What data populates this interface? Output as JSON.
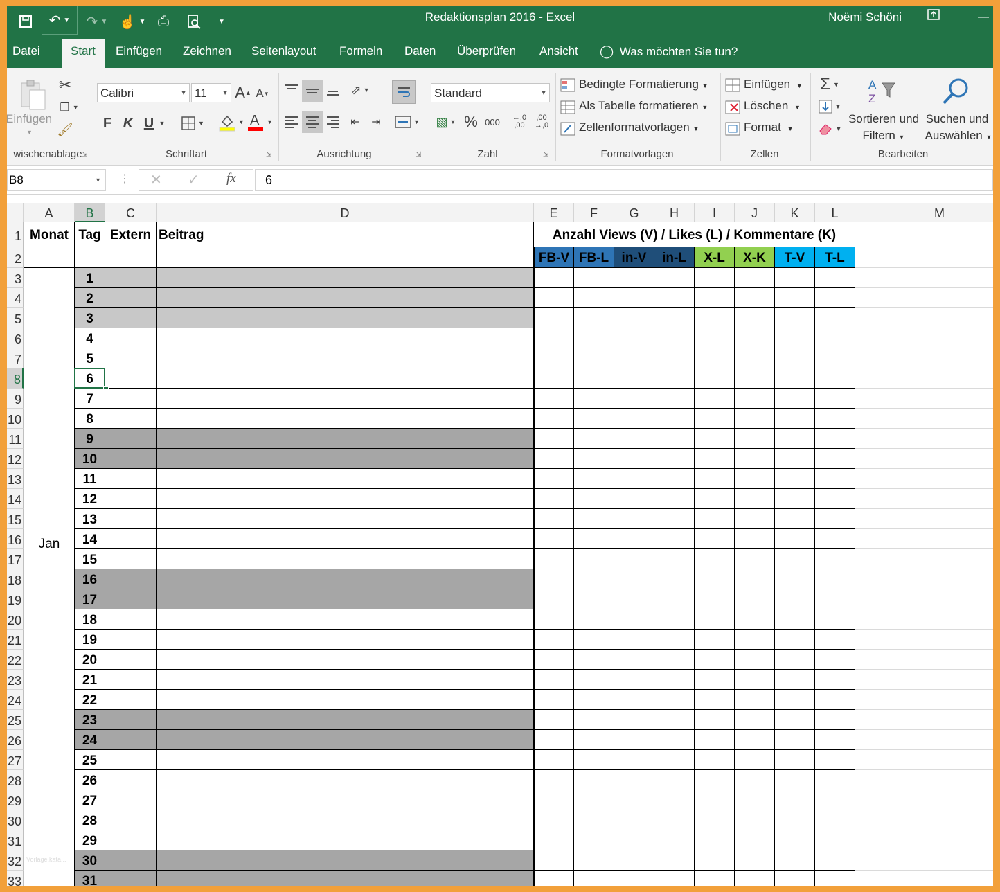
{
  "window": {
    "title": "Redaktionsplan 2016 - Excel",
    "user": "Noëmi Schöni"
  },
  "tabs": [
    "Datei",
    "Start",
    "Einfügen",
    "Zeichnen",
    "Seitenlayout",
    "Formeln",
    "Daten",
    "Überprüfen",
    "Ansicht"
  ],
  "active_tab": "Start",
  "tell_me": "Was möchten Sie tun?",
  "ribbon": {
    "clipboard": {
      "paste_label": "Einfügen",
      "group_label": "wischenablage"
    },
    "font": {
      "font_name": "Calibri",
      "font_size": "11",
      "bold": "F",
      "italic": "K",
      "underline": "U",
      "group_label": "Schriftart"
    },
    "alignment": {
      "group_label": "Ausrichtung"
    },
    "number": {
      "format": "Standard",
      "percent": "%",
      "thousands": "000",
      "group_label": "Zahl"
    },
    "styles": {
      "conditional": "Bedingte Formatierung",
      "as_table": "Als Tabelle formatieren",
      "cell_styles": "Zellenformatvorlagen",
      "group_label": "Formatvorlagen"
    },
    "cells": {
      "insert": "Einfügen",
      "delete": "Löschen",
      "format": "Format",
      "group_label": "Zellen"
    },
    "editing": {
      "sort_l1": "Sortieren und",
      "sort_l2": "Filtern",
      "find_l1": "Suchen und",
      "find_l2": "Auswählen",
      "group_label": "Bearbeiten"
    }
  },
  "formula_bar": {
    "name_box": "B8",
    "fx": "fx",
    "formula": "6"
  },
  "sheet": {
    "columns": [
      "A",
      "B",
      "C",
      "D",
      "E",
      "F",
      "G",
      "H",
      "I",
      "J",
      "K",
      "L",
      "M"
    ],
    "selected_column": "B",
    "selected_row": "8",
    "header": {
      "monat": "Monat",
      "tag": "Tag",
      "extern": "Extern",
      "beitrag": "Beitrag",
      "metrics_title": "Anzahl Views (V) / Likes (L) / Kommentare (K)"
    },
    "metrics": [
      {
        "label": "FB-V",
        "color": "#2e75b6"
      },
      {
        "label": "FB-L",
        "color": "#2e75b6"
      },
      {
        "label": "in-V",
        "color": "#1f4e79"
      },
      {
        "label": "in-L",
        "color": "#1f4e79"
      },
      {
        "label": "X-L",
        "color": "#92d050"
      },
      {
        "label": "X-K",
        "color": "#92d050"
      },
      {
        "label": "T-V",
        "color": "#00b0f0"
      },
      {
        "label": "T-L",
        "color": "#00b0f0"
      }
    ],
    "month": "Jan",
    "rows": [
      {
        "row": "3",
        "tag": "1",
        "shade": "light"
      },
      {
        "row": "4",
        "tag": "2",
        "shade": "light"
      },
      {
        "row": "5",
        "tag": "3",
        "shade": "light"
      },
      {
        "row": "6",
        "tag": "4",
        "shade": "none"
      },
      {
        "row": "7",
        "tag": "5",
        "shade": "none"
      },
      {
        "row": "8",
        "tag": "6",
        "shade": "none"
      },
      {
        "row": "9",
        "tag": "7",
        "shade": "none"
      },
      {
        "row": "10",
        "tag": "8",
        "shade": "none"
      },
      {
        "row": "11",
        "tag": "9",
        "shade": "dark"
      },
      {
        "row": "12",
        "tag": "10",
        "shade": "dark"
      },
      {
        "row": "13",
        "tag": "11",
        "shade": "none"
      },
      {
        "row": "14",
        "tag": "12",
        "shade": "none"
      },
      {
        "row": "15",
        "tag": "13",
        "shade": "none"
      },
      {
        "row": "16",
        "tag": "14",
        "shade": "none"
      },
      {
        "row": "17",
        "tag": "15",
        "shade": "none"
      },
      {
        "row": "18",
        "tag": "16",
        "shade": "dark"
      },
      {
        "row": "19",
        "tag": "17",
        "shade": "dark"
      },
      {
        "row": "20",
        "tag": "18",
        "shade": "none"
      },
      {
        "row": "21",
        "tag": "19",
        "shade": "none"
      },
      {
        "row": "22",
        "tag": "20",
        "shade": "none"
      },
      {
        "row": "23",
        "tag": "21",
        "shade": "none"
      },
      {
        "row": "24",
        "tag": "22",
        "shade": "none"
      },
      {
        "row": "25",
        "tag": "23",
        "shade": "dark"
      },
      {
        "row": "26",
        "tag": "24",
        "shade": "dark"
      },
      {
        "row": "27",
        "tag": "25",
        "shade": "none"
      },
      {
        "row": "28",
        "tag": "26",
        "shade": "none"
      },
      {
        "row": "29",
        "tag": "27",
        "shade": "none"
      },
      {
        "row": "30",
        "tag": "28",
        "shade": "none"
      },
      {
        "row": "31",
        "tag": "29",
        "shade": "none"
      },
      {
        "row": "32",
        "tag": "30",
        "shade": "dark"
      },
      {
        "row": "33",
        "tag": "31",
        "shade": "dark"
      }
    ],
    "shade_colors": {
      "light": "#c8c8c8",
      "dark": "#a6a6a6"
    },
    "watermark": "Vorlage.kata..."
  }
}
